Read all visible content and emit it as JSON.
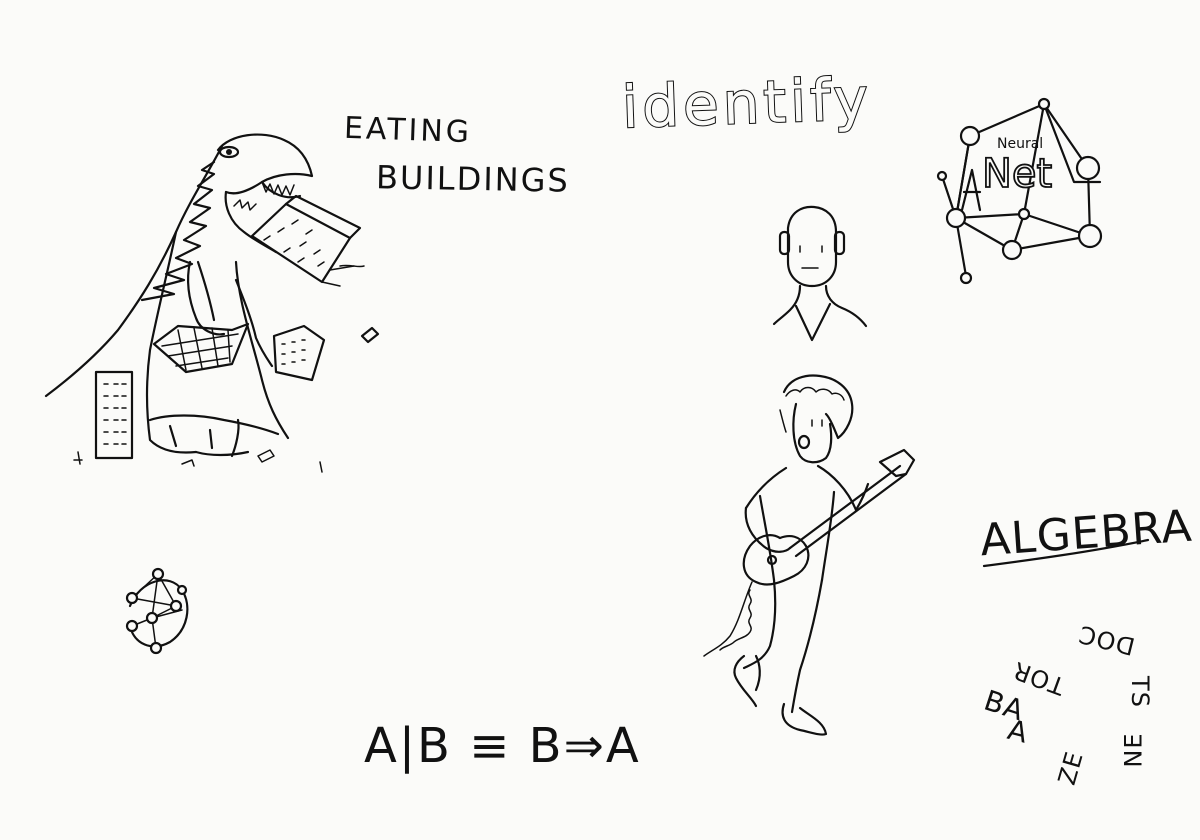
{
  "labels": {
    "eating": "EATING",
    "buildings": "BUILDINGS",
    "identify": "identify",
    "neural": "Neural",
    "net": "Net",
    "algebra": "ALGEBRA",
    "formula": "A|B ≡ B⇒A",
    "spiral_doc": "DOC",
    "spiral_tor": "TOR",
    "spiral_ba": "BA",
    "spiral_a": "A",
    "spiral_ts": "TS",
    "spiral_ze": "ZE",
    "spiral_ne": "NE"
  },
  "ink_color": "#111111",
  "paper_color": "#fbfbf9"
}
